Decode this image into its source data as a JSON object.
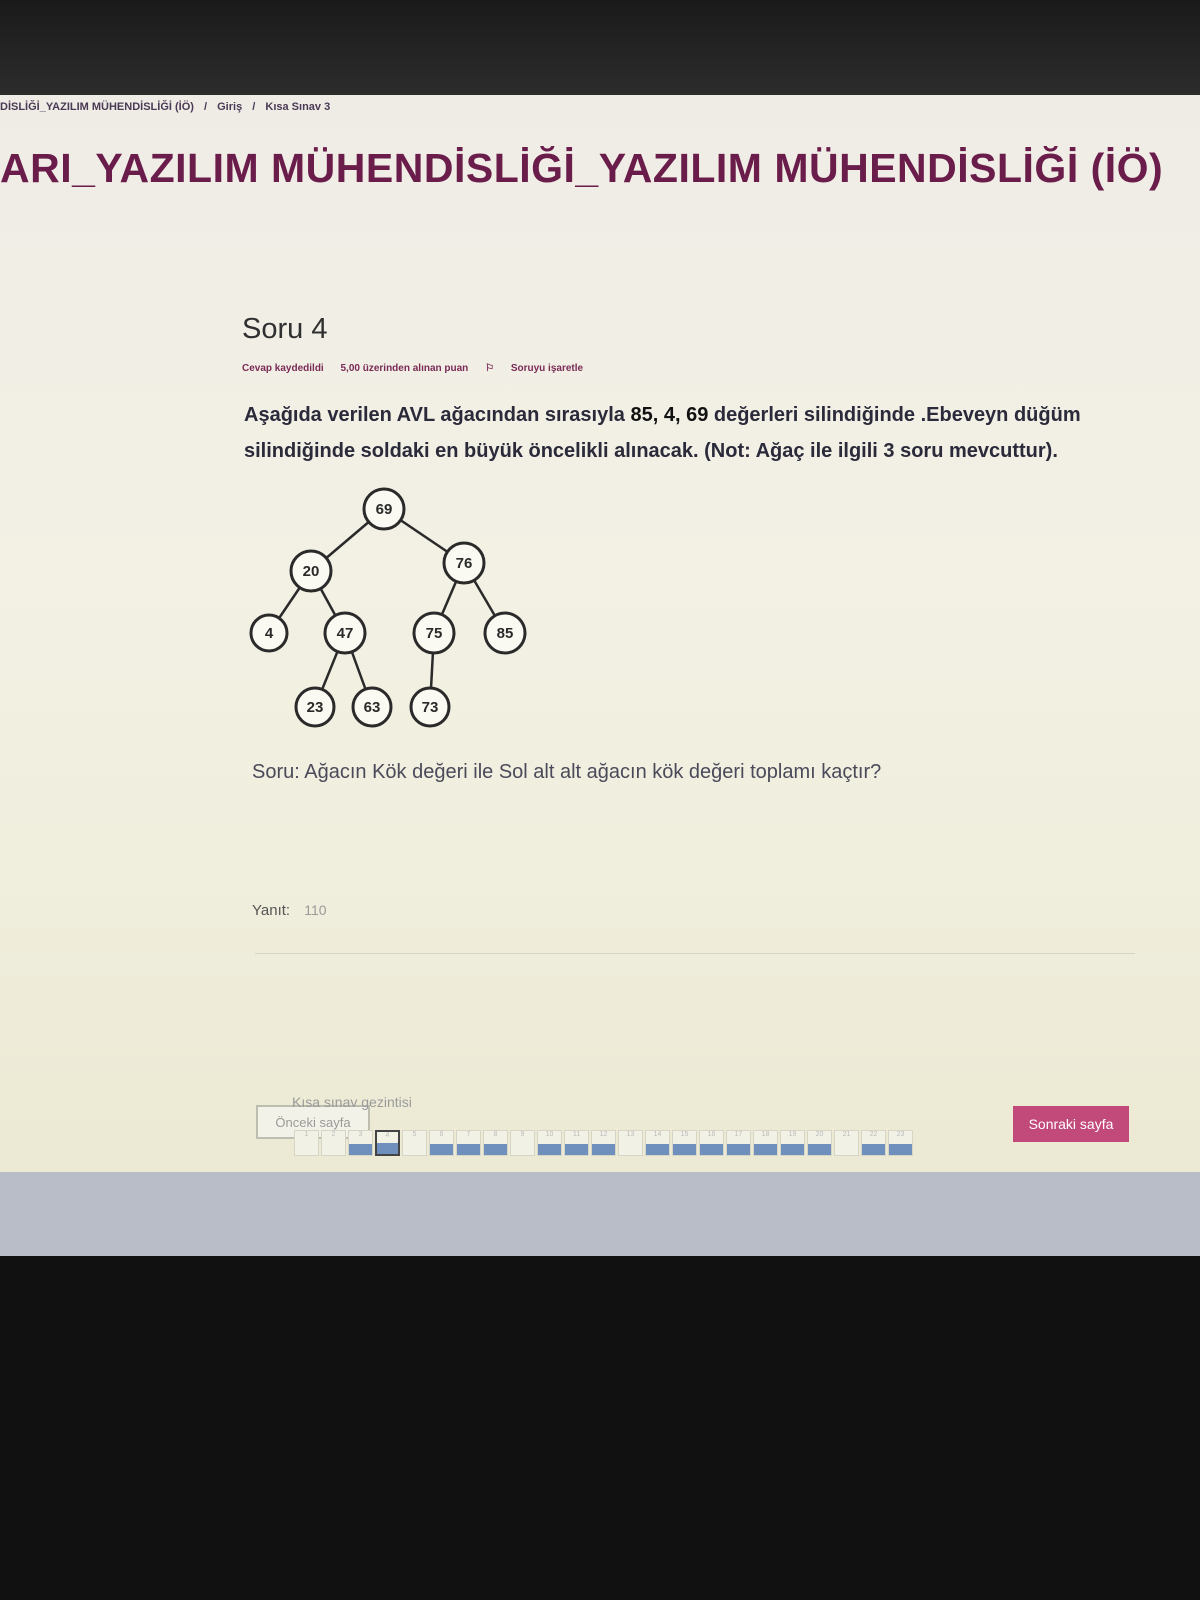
{
  "breadcrumb": {
    "course": "DİSLİĞİ_YAZILIM MÜHENDİSLİĞİ (İÖ)",
    "home": "Giriş",
    "quiz": "Kısa Sınav 3",
    "separator": "/"
  },
  "course_title": "ARI_YAZILIM MÜHENDİSLİĞİ_YAZILIM MÜHENDİSLİĞİ (İÖ)",
  "question": {
    "number": "Soru 4",
    "status": "Cevap kaydedildi",
    "points": "5,00 üzerinden alınan puan",
    "flag_label": "Soruyu işaretle",
    "text_part1": "Aşağıda verilen AVL ağacından sırasıyla ",
    "text_highlight": "85, 4, 69",
    "text_part2": " değerleri silindiğinde .Ebeveyn düğüm silindiğinde soldaki en büyük öncelikli alınacak. (Not: Ağaç ile ilgili 3 soru mevcuttur).",
    "subquestion": "Soru: Ağacın Kök değeri ile Sol alt alt ağacın kök değeri toplamı kaçtır?",
    "answer_label": "Yanıt:",
    "answer_value": "110"
  },
  "tree": {
    "nodes": [
      {
        "id": "n69",
        "label": "69"
      },
      {
        "id": "n20",
        "label": "20"
      },
      {
        "id": "n76",
        "label": "76"
      },
      {
        "id": "n4",
        "label": "4"
      },
      {
        "id": "n47",
        "label": "47"
      },
      {
        "id": "n75",
        "label": "75"
      },
      {
        "id": "n85",
        "label": "85"
      },
      {
        "id": "n23",
        "label": "23"
      },
      {
        "id": "n63",
        "label": "63"
      },
      {
        "id": "n73",
        "label": "73"
      }
    ]
  },
  "buttons": {
    "prev": "Önceki sayfa",
    "next": "Sonraki sayfa"
  },
  "quiz_nav": {
    "title": "Kısa sınav gezintisi",
    "cells": [
      {
        "label": "1",
        "answered": false
      },
      {
        "label": "2",
        "answered": false
      },
      {
        "label": "3",
        "answered": true
      },
      {
        "label": "4",
        "answered": true,
        "current": true
      },
      {
        "label": "5",
        "answered": false
      },
      {
        "label": "6",
        "answered": true
      },
      {
        "label": "7",
        "answered": true
      },
      {
        "label": "8",
        "answered": true
      },
      {
        "label": "9",
        "answered": false
      },
      {
        "label": "10",
        "answered": true
      },
      {
        "label": "11",
        "answered": true
      },
      {
        "label": "12",
        "answered": true
      },
      {
        "label": "13",
        "answered": false
      },
      {
        "label": "14",
        "answered": true
      },
      {
        "label": "15",
        "answered": true
      },
      {
        "label": "16",
        "answered": true
      },
      {
        "label": "17",
        "answered": true
      },
      {
        "label": "18",
        "answered": true
      },
      {
        "label": "19",
        "answered": true
      },
      {
        "label": "20",
        "answered": true
      },
      {
        "label": "21",
        "answered": false
      },
      {
        "label": "22",
        "answered": true
      },
      {
        "label": "23",
        "answered": true
      }
    ]
  },
  "colors": {
    "accent": "#c24a7a",
    "title": "#6a1c4a",
    "answered_cell": "#6f8fbd"
  }
}
